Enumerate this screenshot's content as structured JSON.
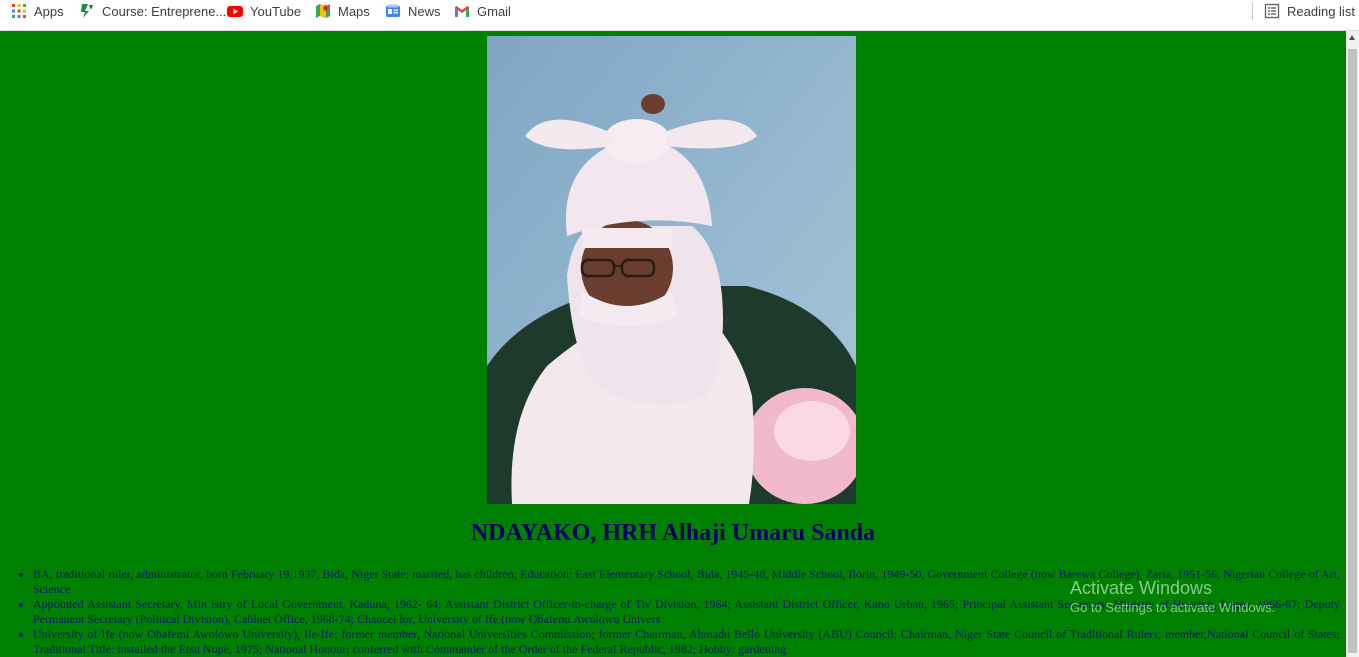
{
  "bookmarks": {
    "items": [
      {
        "label": "Apps",
        "icon": "apps-grid-icon"
      },
      {
        "label": "Course: Entreprene...",
        "icon": "course-s-logo-icon"
      },
      {
        "label": "YouTube",
        "icon": "youtube-icon"
      },
      {
        "label": "Maps",
        "icon": "maps-icon"
      },
      {
        "label": "News",
        "icon": "news-icon"
      },
      {
        "label": "Gmail",
        "icon": "gmail-icon"
      }
    ],
    "reading_list": "Reading list"
  },
  "page": {
    "background": "#008000",
    "title": "NDAYAKO, HRH Alhaji Umaru Sanda",
    "bio": [
      "BA, traditional ruler, administrator, born February 19,1937, Bida, Niger State; married, has children; Education: East Elementary School, Bida, 1945-48, Middle School, Ilorin, 1949-50, Government College (now Barewa College), Zaria, 1951-56, Nigerian College of Art, Science",
      "Appointed Assistant Secretary, Min istry of Local Government, Kaduna, 1962- 64; Assistant District Officer-in-charge of Tiv Division, 1964; Assistant District Officer, Kano Urban, 1965; Principal Assistant Sec-retary, Ministry of Housing, Lagos, 1966-67; Deputy Permanent Secretary (Political Division), Cabinet Office, 1968-74; Chancel lor, University of Ife (now Obafemi Awolowo Univers",
      "University of Ife (now Obafemi Awolowo University), Ile-Ife; former member, National Universities Commission; former Chairman, Ahmadu Bello University (ABU) Council; Chairman, Niger State Council of Traditional Rulers; member,National Council of States; Traditional Title: installed the Etsu Nupe, 1975; National Honour: conferred with Commander of the Order of the Federal Republic, 1982; Hobby: gardening"
    ]
  },
  "watermark": {
    "line1": "Activate Windows",
    "line2": "Go to Settings to activate Windows."
  }
}
